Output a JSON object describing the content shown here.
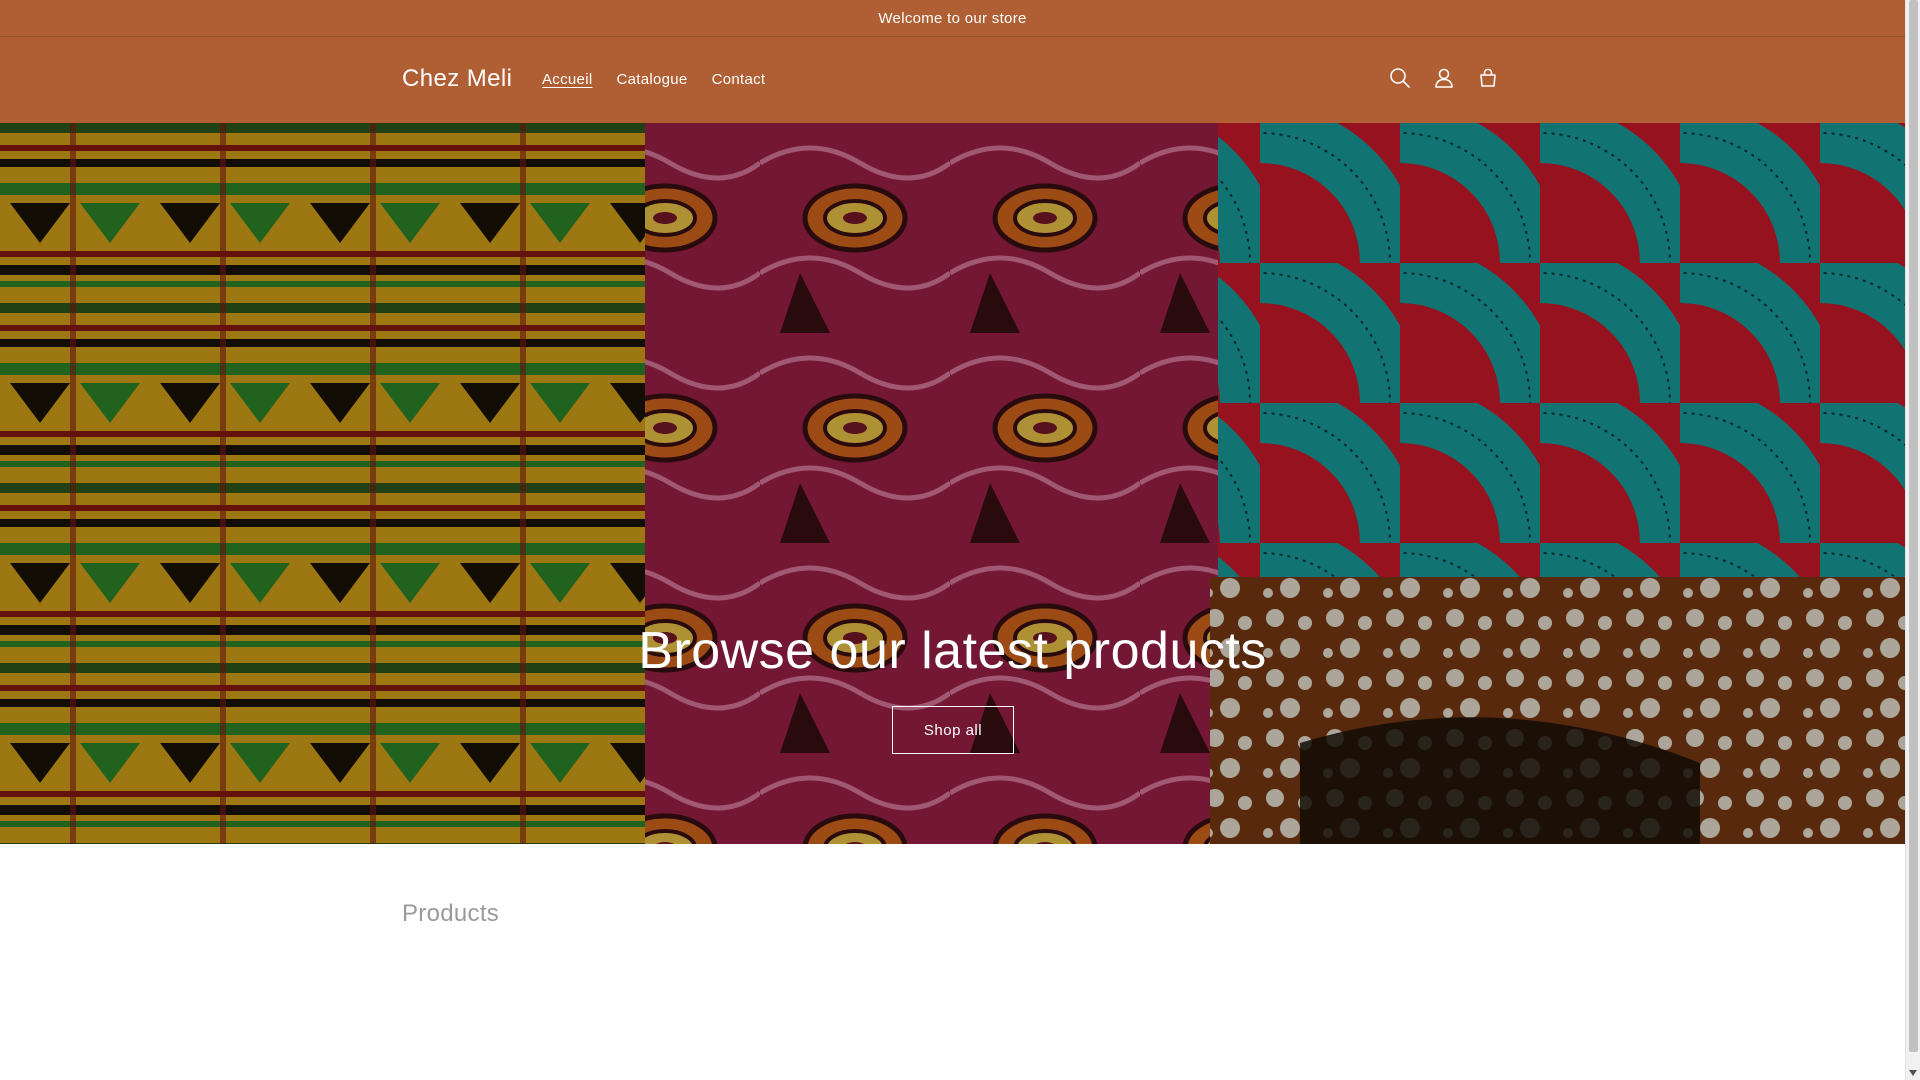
{
  "announcement": {
    "text": "Welcome to our store"
  },
  "header": {
    "brand": "Chez Meli",
    "nav": [
      {
        "label": "Accueil",
        "active": true
      },
      {
        "label": "Catalogue",
        "active": false
      },
      {
        "label": "Contact",
        "active": false
      }
    ],
    "icons": [
      "search-icon",
      "account-icon",
      "cart-icon"
    ],
    "background_color": "#b05e33"
  },
  "hero": {
    "title": "Browse our latest products",
    "button_label": "Shop all"
  },
  "products": {
    "title": "Products"
  }
}
